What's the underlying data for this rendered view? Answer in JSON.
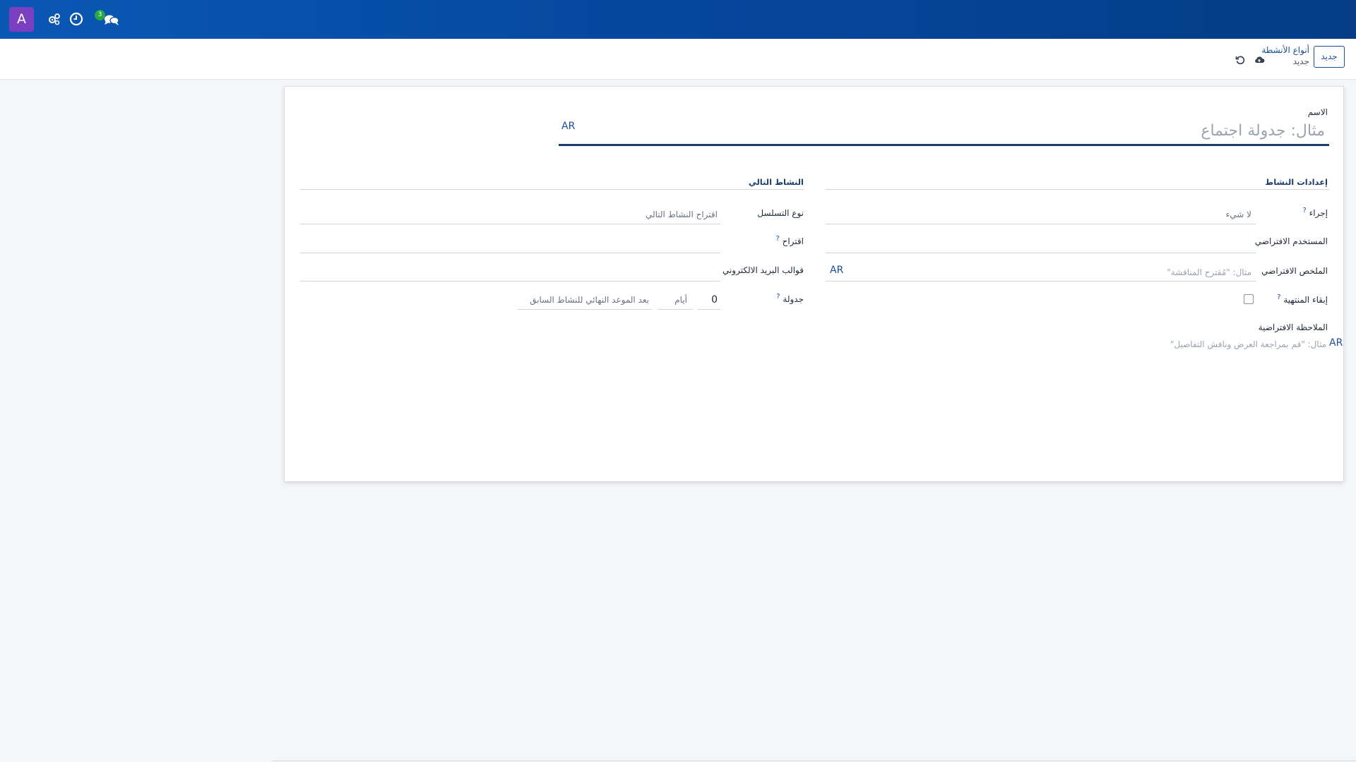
{
  "navbar": {
    "avatar_letter": "A",
    "icons": [
      "cogs-icon",
      "clock-icon",
      "chat-icon"
    ],
    "chat_badge": "3",
    "background": "#0548a0"
  },
  "control_panel": {
    "new_button": "جديد",
    "breadcrumb_parent": "أنواع الأنشطة",
    "breadcrumb_current": "جديد"
  },
  "form": {
    "name_label": "الاسم",
    "name_placeholder": "مثال: جدولة اجتماع",
    "lang_tag": "AR",
    "sections": {
      "activity_settings": "إعدادات النشاط",
      "next_activity": "النشاط التالي"
    },
    "fields": {
      "action_label": "إجراء",
      "action_value": "لا شيء",
      "default_user_label": "المستخدم الافتراضي",
      "default_summary_label": "الملخص الافتراضي",
      "default_summary_placeholder": "مثال: \"مُقترح المناقشة\"",
      "keep_done_label": "إبقاء المنتهية",
      "default_note_label": "الملاحظة الافتراضية",
      "default_note_placeholder": "مثال: \"قم بمراجعة العرض وناقش التفاصيل\"",
      "chaining_type_label": "نوع التسلسل",
      "chaining_type_value": "اقتراح النشاط التالي",
      "suggest_label": "اقتراح",
      "email_templates_label": "قوالب البريد الالكتروني",
      "schedule_label": "جدولة",
      "schedule_delay": "0",
      "schedule_unit": "أيام",
      "schedule_from": "بعد الموعد النهائي للنشاط السابق",
      "help_mark": "?"
    }
  }
}
